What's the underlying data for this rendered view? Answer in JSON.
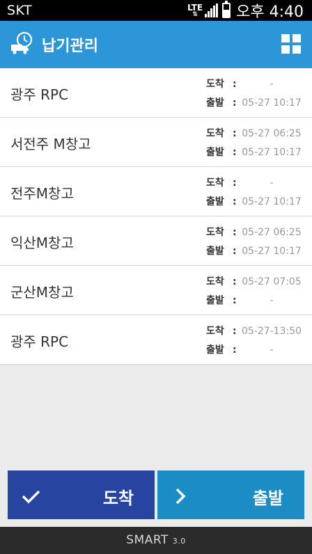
{
  "status_bar": {
    "carrier": "SKT",
    "network": "LTE",
    "time": "오후 4:40"
  },
  "header": {
    "title": "납기관리",
    "app_icon": "clock-truck-icon",
    "menu_icon": "grid-icon"
  },
  "labels": {
    "arrive": "도착",
    "depart": "출발",
    "colon": ":"
  },
  "stops": [
    {
      "name": "광주 RPC",
      "arrive": "-",
      "depart": "05-27  10:17"
    },
    {
      "name": "서전주 M창고",
      "arrive": "05-27  06:25",
      "depart": "05-27  10:17"
    },
    {
      "name": "전주M창고",
      "arrive": "-",
      "depart": "05-27  10:17"
    },
    {
      "name": "익산M창고",
      "arrive": "05-27  06:25",
      "depart": "05-27  10:17"
    },
    {
      "name": "군산M창고",
      "arrive": "05-27  07:05",
      "depart": "-"
    },
    {
      "name": "광주 RPC",
      "arrive": "05-27-13:50",
      "depart": "-"
    }
  ],
  "actions": {
    "arrive_label": "도착",
    "depart_label": "출발",
    "arrive_icon": "check-icon",
    "depart_icon": "chevron-right-icon",
    "arrive_color": "#2644a0",
    "depart_color": "#1b8dc4"
  },
  "footer": {
    "brand": "SMART",
    "version": "3.0"
  },
  "colors": {
    "accent": "#2b97d8"
  }
}
